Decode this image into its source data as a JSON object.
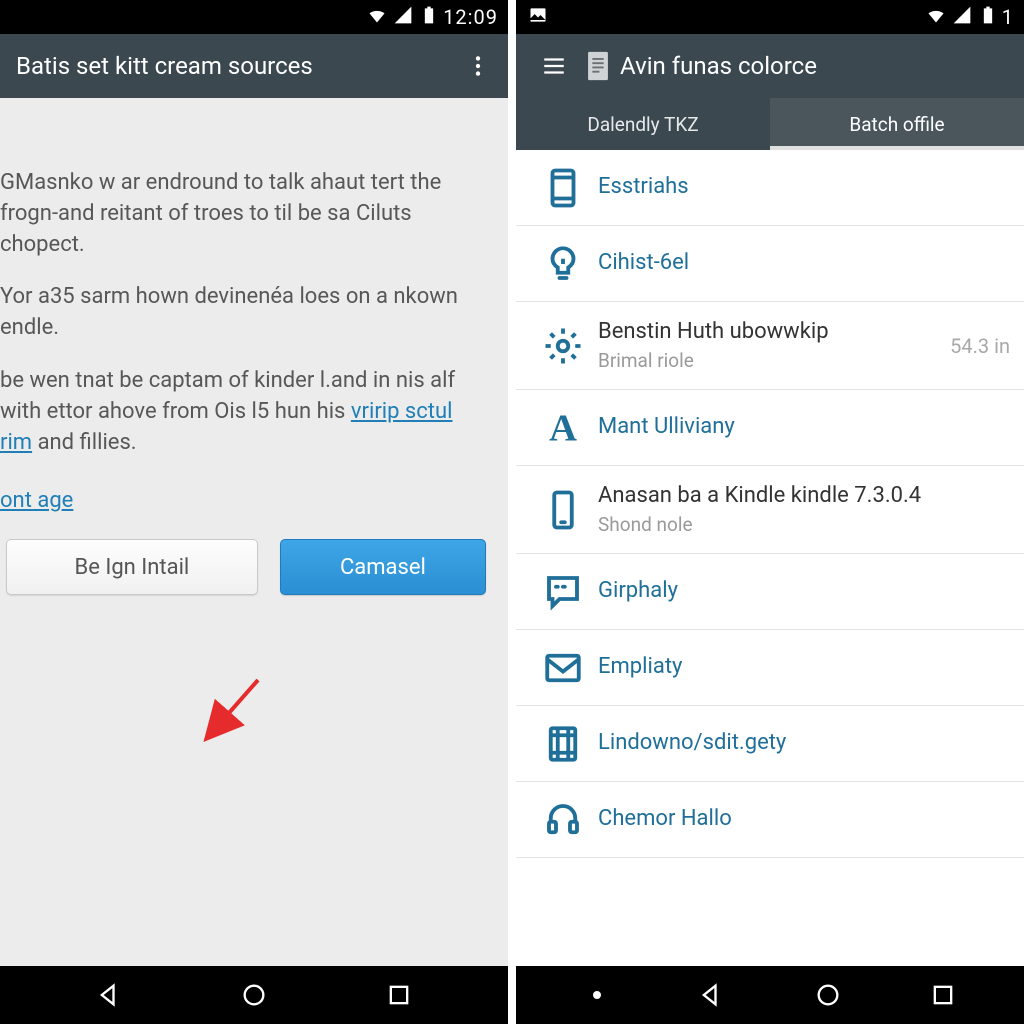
{
  "left": {
    "status": {
      "clock": "12:09"
    },
    "toolbar": {
      "title": "Batis set kitt cream sources"
    },
    "paragraphs": [
      "GMasnko w ar endround to talk ahaut tert the frogn-and reitant of troes to til be sa Ciluts chopect.",
      "Yor a35 sarm hown devinenéa loes on a nkown endle."
    ],
    "para3_pre": "be wen tnat be captam of kinder l.and in nis alf with ettor ahove from Ois l5 hun his ",
    "para3_link": "vririp sctul rim",
    "para3_post": " and fillies.",
    "link_line": "ont age",
    "buttons": {
      "install": "Be Ign Intail",
      "cancel": "Camasel"
    }
  },
  "right": {
    "toolbar": {
      "title": "Avin funas colorce"
    },
    "tabs": [
      {
        "label": "Dalendly TKZ",
        "active": false
      },
      {
        "label": "Batch offile",
        "active": true
      }
    ],
    "items": [
      {
        "kind": "single",
        "icon": "tablet",
        "title": "Esstriahs"
      },
      {
        "kind": "single",
        "icon": "bulb",
        "title": "Cihist-6el"
      },
      {
        "kind": "double",
        "icon": "gear",
        "title": "Benstin Huth ubowwkip",
        "trailing": "54.3 in",
        "sub": "Brimal riole"
      },
      {
        "kind": "single",
        "icon": "letter-a",
        "title": "Mant Ulliviany"
      },
      {
        "kind": "double",
        "icon": "phone",
        "title": "Anasan ba a Kindle kindle 7.3.0.4",
        "sub": "Shond nole"
      },
      {
        "kind": "single",
        "icon": "chat",
        "title": "Girphaly"
      },
      {
        "kind": "single",
        "icon": "mail",
        "title": "Empliaty"
      },
      {
        "kind": "single",
        "icon": "film",
        "title": "Lindowno/sdit.gety"
      },
      {
        "kind": "single",
        "icon": "headset",
        "title": "Chemor Hallo"
      }
    ]
  }
}
